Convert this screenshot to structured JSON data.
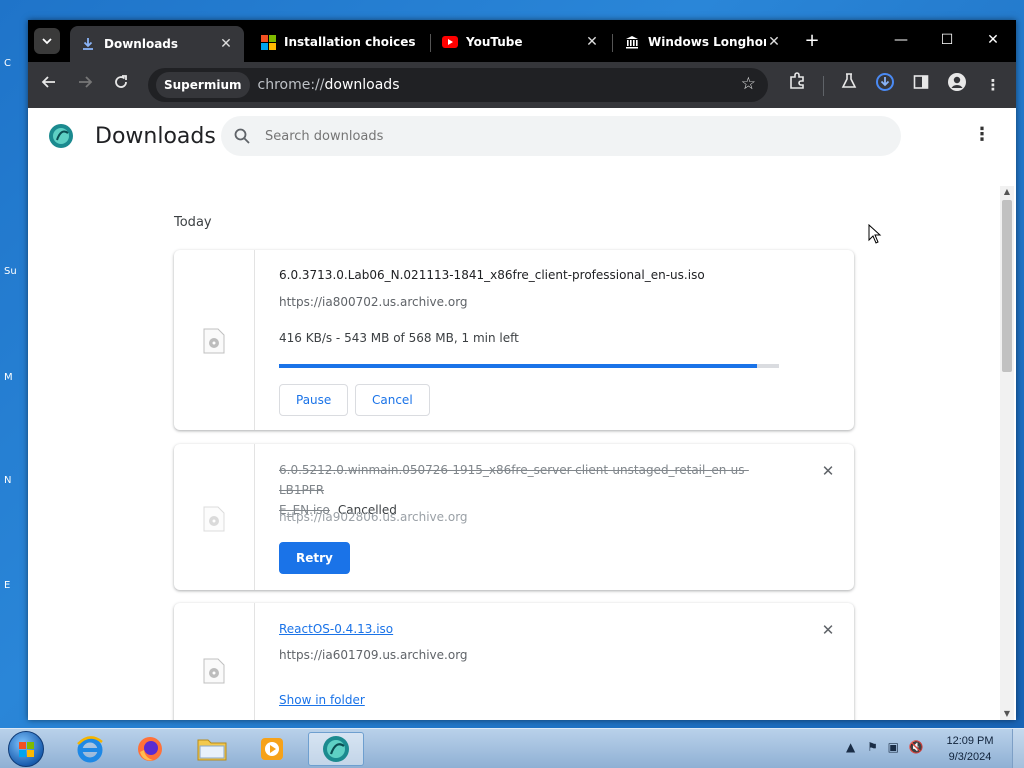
{
  "colors": {
    "accent": "#1a73e8",
    "tabstrip": "#000000",
    "toolbar": "#35363a",
    "progress_fill": "#1a73e8"
  },
  "tabs": [
    {
      "title": "Downloads",
      "icon": "download-icon",
      "active": true
    },
    {
      "title": "Installation choices",
      "icon": "windows-icon",
      "active": false
    },
    {
      "title": "YouTube",
      "icon": "youtube-icon",
      "active": false
    },
    {
      "title": "Windows Longhorn",
      "icon": "archive-icon",
      "active": false
    }
  ],
  "omnibox": {
    "chip": "Supermium",
    "url_prefix": "chrome://",
    "url_host": "downloads"
  },
  "page": {
    "title": "Downloads",
    "search_placeholder": "Search downloads",
    "section_label": "Today"
  },
  "downloads": [
    {
      "filename": "6.0.3713.0.Lab06_N.021113-1841_x86fre_client-professional_en-us.iso",
      "origin": "https://ia800702.us.archive.org",
      "progress_text": "416 KB/s - 543 MB of 568 MB, 1 min left",
      "progress_fraction": 0.956,
      "pause_label": "Pause",
      "cancel_label": "Cancel"
    },
    {
      "filename": "6.0.5212.0.winmain.050726-1915_x86fre_server-client-unstaged_retail_en-us-LB1PFRE_EN.iso",
      "filename_line1": "6.0.5212.0.winmain.050726-1915_x86fre_server-client-unstaged_retail_en-us-LB1PFR",
      "filename_line2": "E_EN.iso",
      "status": "Cancelled",
      "origin": "https://ia902806.us.archive.org",
      "retry_label": "Retry"
    },
    {
      "filename": "ReactOS-0.4.13.iso",
      "origin": "https://ia601709.us.archive.org",
      "show_in_folder_label": "Show in folder"
    }
  ],
  "taskbar": {
    "time": "12:09 PM",
    "date": "9/3/2024"
  }
}
